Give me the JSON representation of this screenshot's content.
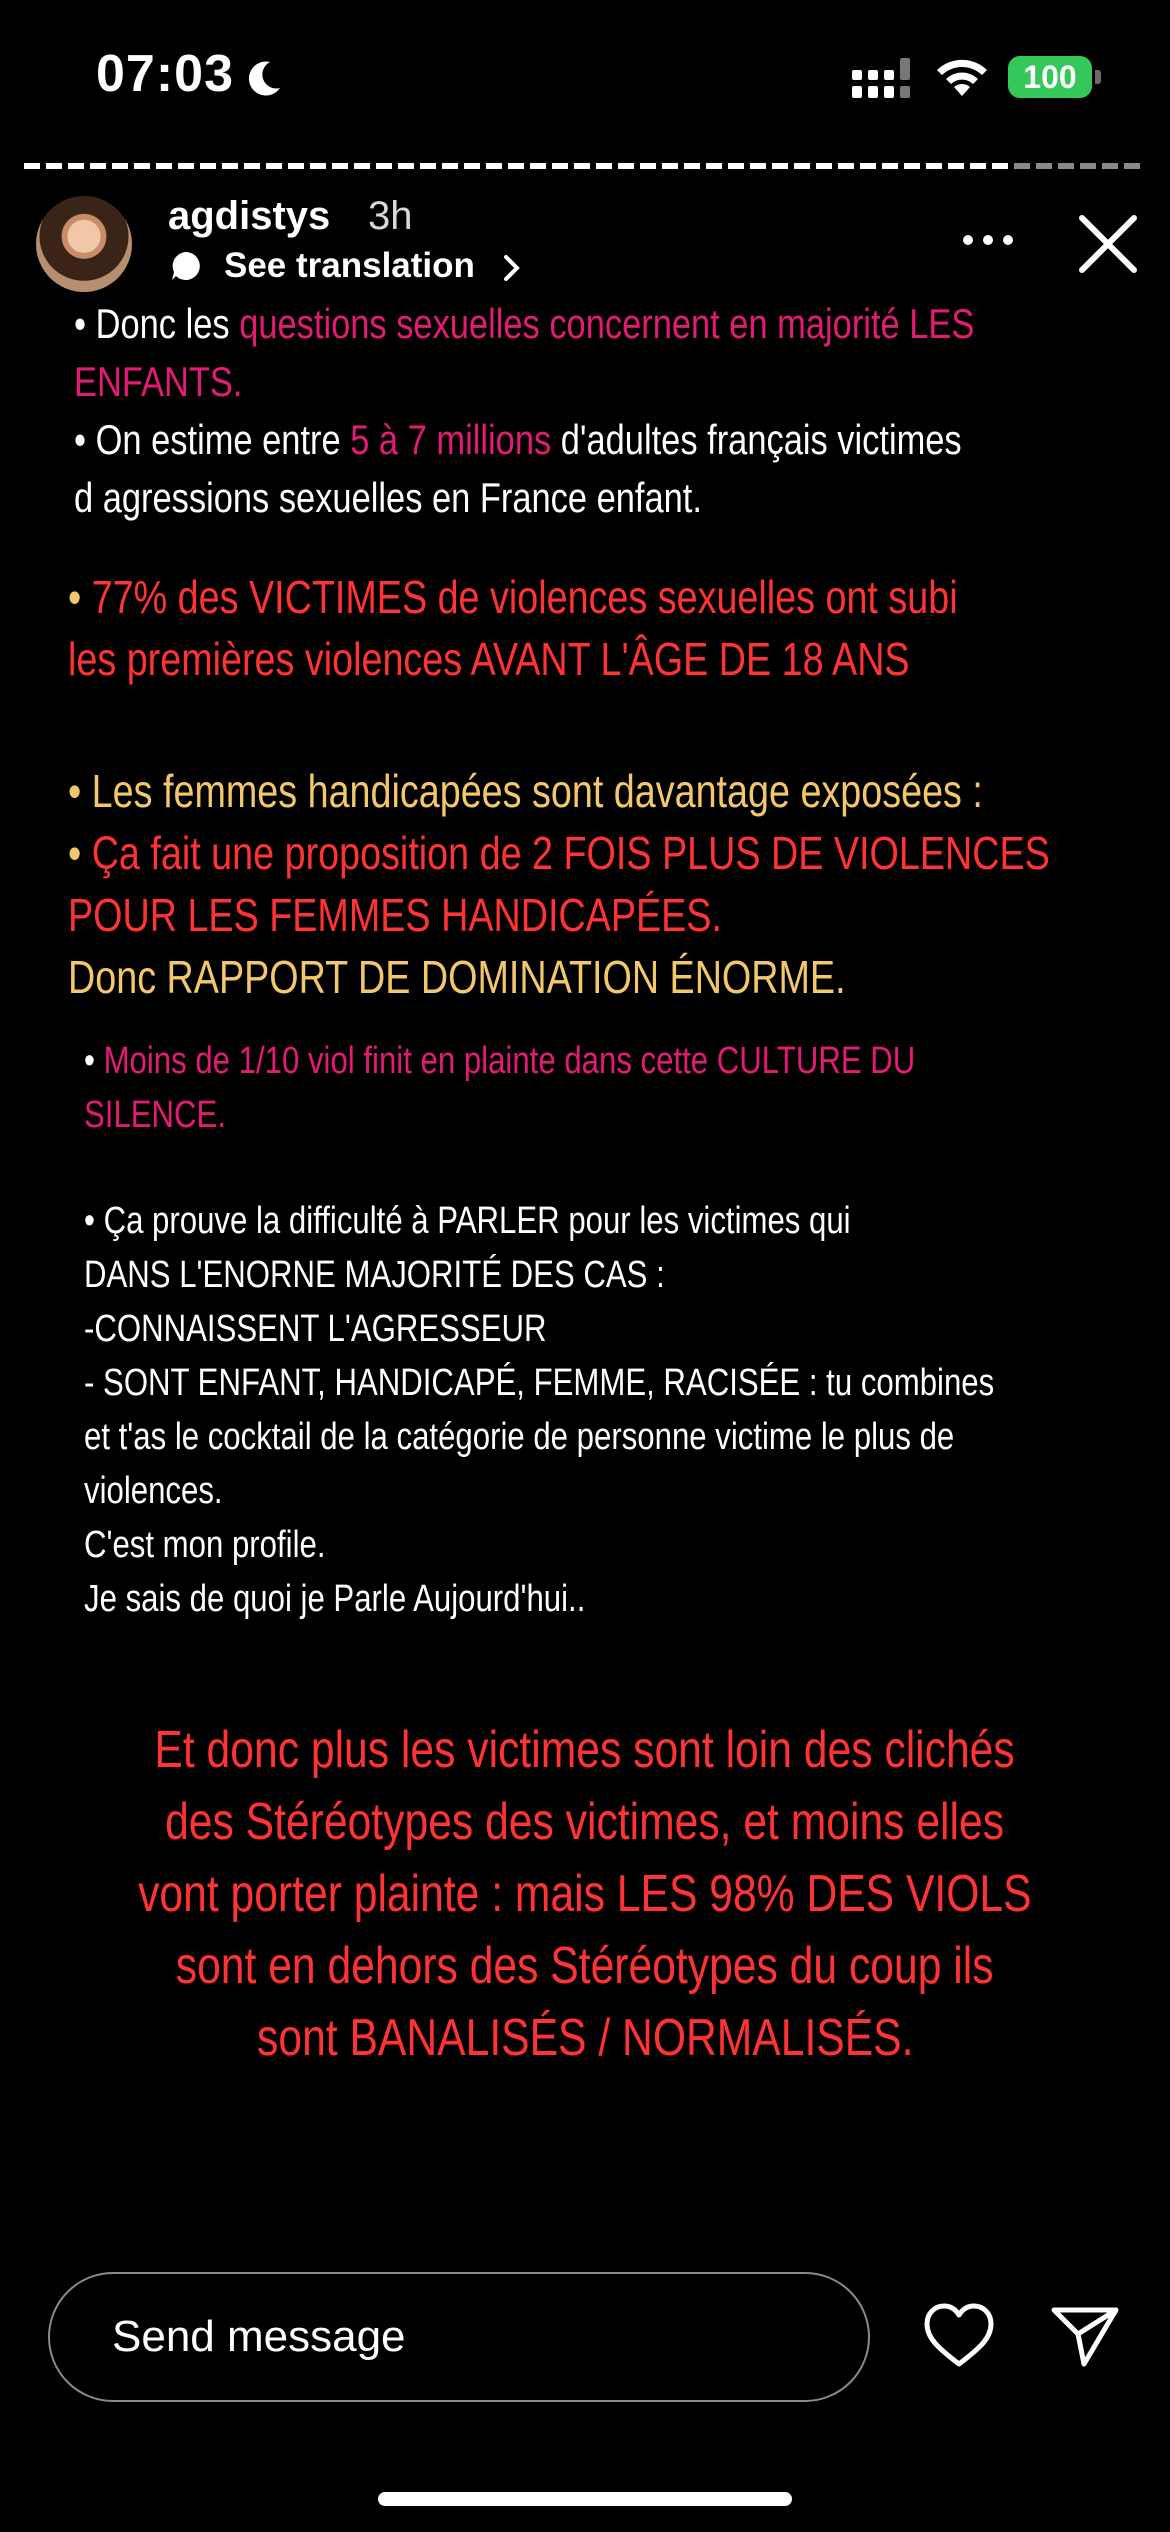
{
  "status_bar": {
    "time": "07:03",
    "battery": "100",
    "icons": [
      "moon-icon",
      "signal-icon",
      "wifi-icon",
      "battery-icon"
    ]
  },
  "story": {
    "progress": 0.88,
    "username": "agdistys",
    "timestamp": "3h",
    "see_translation": "See translation"
  },
  "content": {
    "l1a": "• Donc les ",
    "l1b": "questions sexuelles concernent en majorité LES",
    "l2": "ENFANTS.",
    "l3a": "• On estime entre ",
    "l3b": "5 à 7 millions",
    "l3c": " d'adultes français victimes",
    "l4": "d agressions sexuelles en France enfant.",
    "l5a": "• ",
    "l5b": "77% des VICTIMES de violences sexuelles ont subi",
    "l6": "les premières violences AVANT L'ÂGE DE 18 ANS",
    "l7": "• Les femmes handicapées sont davantage exposées :",
    "l8a": "• ",
    "l8b": "Ça fait une proposition de 2 FOIS PLUS DE VIOLENCES",
    "l9": "POUR LES FEMMES HANDICAPÉES.",
    "l10a": "Donc ",
    "l10b": "RAPPORT DE DOMINATION ÉNORME.",
    "l11a": "• ",
    "l11b": "Moins de 1/10 viol  finit en plainte dans cette CULTURE DU",
    "l12": "SILENCE.",
    "l13": "• Ça prouve la difficulté à PARLER pour les victimes qui",
    "l14": "DANS L'ENORNE MAJORITÉ DES CAS :",
    "l15": "-CONNAISSENT L'AGRESSEUR",
    "l16": "- SONT ENFANT, HANDICAPÉ, FEMME, RACISÉE : tu combines",
    "l17": "et t'as le cocktail de la catégorie de personne victime le plus de",
    "l18": "violences.",
    "l19": "C'est mon profile.",
    "l20": "Je sais de quoi je Parle Aujourd'hui..",
    "c1": "Et donc plus les victimes sont loin des clichés",
    "c2": "des Stéréotypes des victimes, et moins elles",
    "c3": "vont porter plainte : mais LES 98% DES VIOLS",
    "c4": "sont en dehors des Stéréotypes du coup ils",
    "c5": "sont BANALISÉS / NORMALISÉS."
  },
  "footer": {
    "message_placeholder": "Send message",
    "icons": [
      "heart-icon",
      "send-icon"
    ]
  }
}
